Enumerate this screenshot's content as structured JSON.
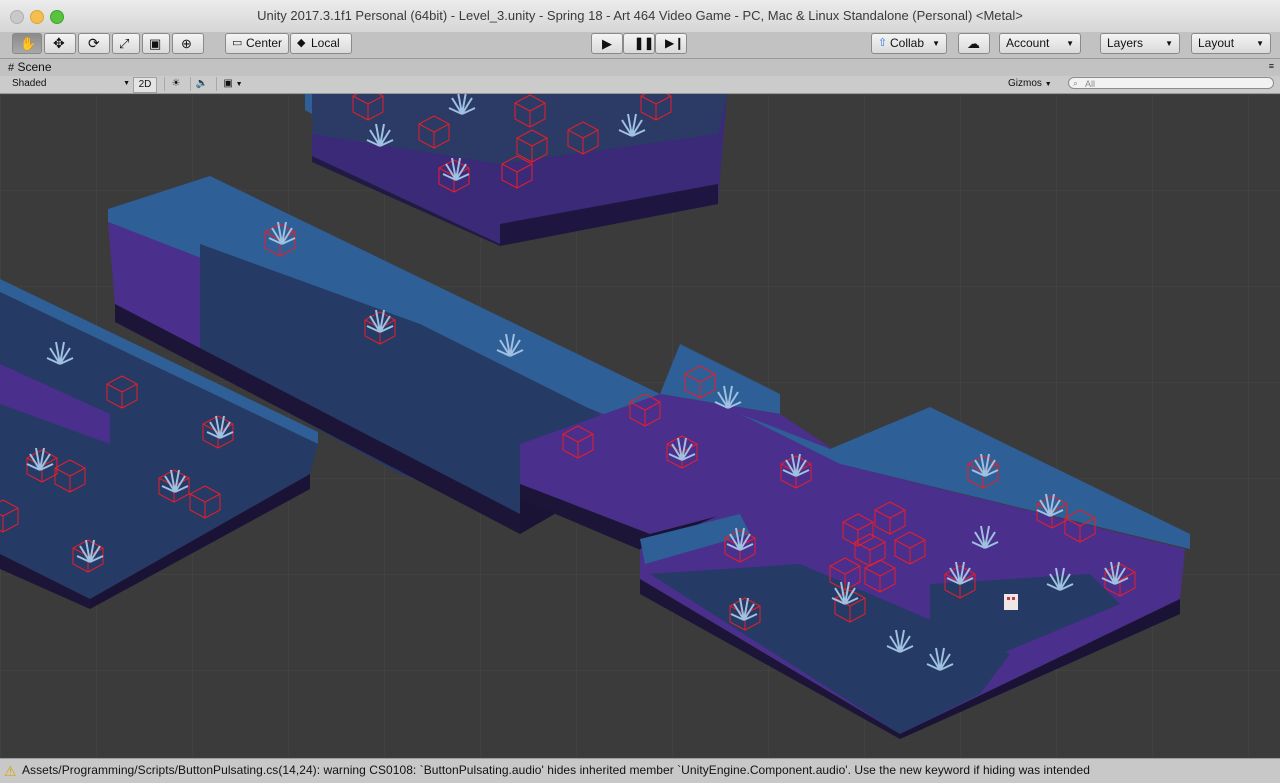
{
  "window": {
    "title": "Unity 2017.3.1f1 Personal (64bit) - Level_3.unity - Spring 18 - Art 464 Video Game - PC, Mac & Linux Standalone (Personal) <Metal>"
  },
  "toolbar": {
    "tools": [
      "hand-icon",
      "move-icon",
      "rotate-icon",
      "scale-icon",
      "rect-icon",
      "transform-icon"
    ],
    "pivot_label": "Center",
    "space_label": "Local",
    "collab_label": "Collab",
    "account_label": "Account",
    "layers_label": "Layers",
    "layout_label": "Layout"
  },
  "scene": {
    "tab_label": "Scene",
    "shading_mode": "Shaded",
    "mode_2d_label": "2D",
    "gizmos_label": "Gizmos",
    "search_placeholder": "All"
  },
  "console": {
    "message": "Assets/Programming/Scripts/ButtonPulsating.cs(14,24): warning CS0108: `ButtonPulsating.audio' hides inherited member `UnityEngine.Component.audio'. Use the new keyword if hiding was intended"
  },
  "colors": {
    "viewport_bg": "#3b3b3b",
    "grid": "#4a4a4a",
    "wall": "#2e5f96",
    "floor_purple": "#54308f",
    "floor_dark": "#263a66",
    "gizmo": "#e81e2a",
    "plant": "#9fc0e0"
  }
}
